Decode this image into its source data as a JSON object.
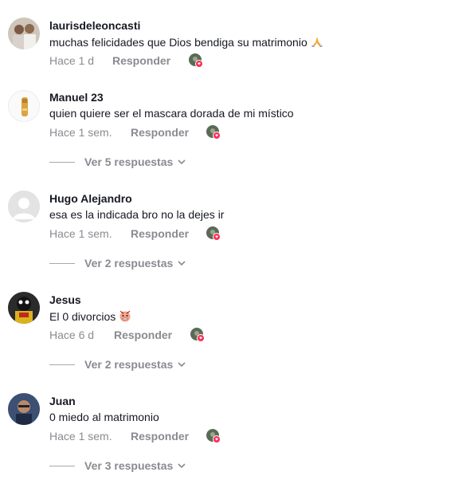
{
  "comments": [
    {
      "username": "laurisdeleoncasti",
      "text": "muchas felicidades que Dios bendiga su matrimonio",
      "emoji": "praying-hands-icon",
      "time": "Hace 1 d",
      "reply_label": "Responder"
    },
    {
      "username": "Manuel 23",
      "text": "quien quiere ser el mascara dorada de mi místico",
      "time": "Hace 1 sem.",
      "reply_label": "Responder",
      "view_replies": "Ver 5 respuestas"
    },
    {
      "username": "Hugo Alejandro",
      "text": "esa es la indicada bro no la dejes ir",
      "time": "Hace 1 sem.",
      "reply_label": "Responder",
      "view_replies": "Ver 2 respuestas"
    },
    {
      "username": "Jesus",
      "text": "El 0 divorcios",
      "emoji": "angry-face-icon",
      "time": "Hace 6 d",
      "reply_label": "Responder",
      "view_replies": "Ver 2 respuestas"
    },
    {
      "username": "Juan",
      "text": "0 miedo al matrimonio",
      "time": "Hace 1 sem.",
      "reply_label": "Responder",
      "view_replies": "Ver 3 respuestas"
    }
  ],
  "colors": {
    "primary_text": "#161823",
    "secondary_text": "#8a8b91",
    "badge_red": "#fe2c55"
  }
}
